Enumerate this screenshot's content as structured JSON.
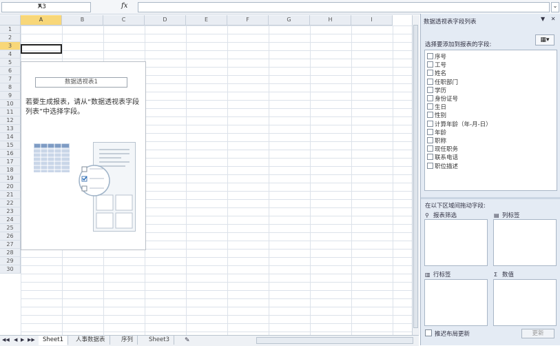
{
  "formula_bar": {
    "name_box": "A3",
    "fx": "fx",
    "formula": ""
  },
  "grid": {
    "columns": [
      "A",
      "B",
      "C",
      "D",
      "E",
      "F",
      "G",
      "H",
      "I"
    ],
    "selected_column": "A",
    "rows": [
      "1",
      "2",
      "3",
      "4",
      "5",
      "6",
      "7",
      "8",
      "9",
      "10",
      "11",
      "12",
      "13",
      "14",
      "15",
      "16",
      "17",
      "18",
      "19",
      "20",
      "21",
      "22",
      "23",
      "24",
      "25",
      "26",
      "27",
      "28",
      "29",
      "30"
    ],
    "selected_row": "3"
  },
  "pivot_placeholder": {
    "title": "数据透视表1",
    "message": "若要生成报表，请从“数据透视表字段列表”中选择字段。"
  },
  "sheet_tabs": {
    "tabs": [
      "Sheet1",
      "人事数据表",
      "序列",
      "Sheet3"
    ],
    "active": "Sheet1"
  },
  "field_pane": {
    "title": "数据透视表字段列表",
    "choose_label": "选择要添加到报表的字段:",
    "fields": [
      "序号",
      "工号",
      "姓名",
      "任职部门",
      "学历",
      "身份证号",
      "生日",
      "性别",
      "计算年龄（年-月-日）",
      "年龄",
      "职称",
      "现任职务",
      "联系电话",
      "职位描述"
    ],
    "drag_label": "在以下区域间拖动字段:",
    "zones": {
      "report_filter": "报表筛选",
      "column_labels": "列标签",
      "row_labels": "行标签",
      "values": "数值"
    },
    "defer_label": "推迟布局更新",
    "update_label": "更新"
  },
  "colors": {
    "selected_header": "#f8d779",
    "pane_bg": "#e4ebf4",
    "grid_line": "#dce2ea"
  }
}
